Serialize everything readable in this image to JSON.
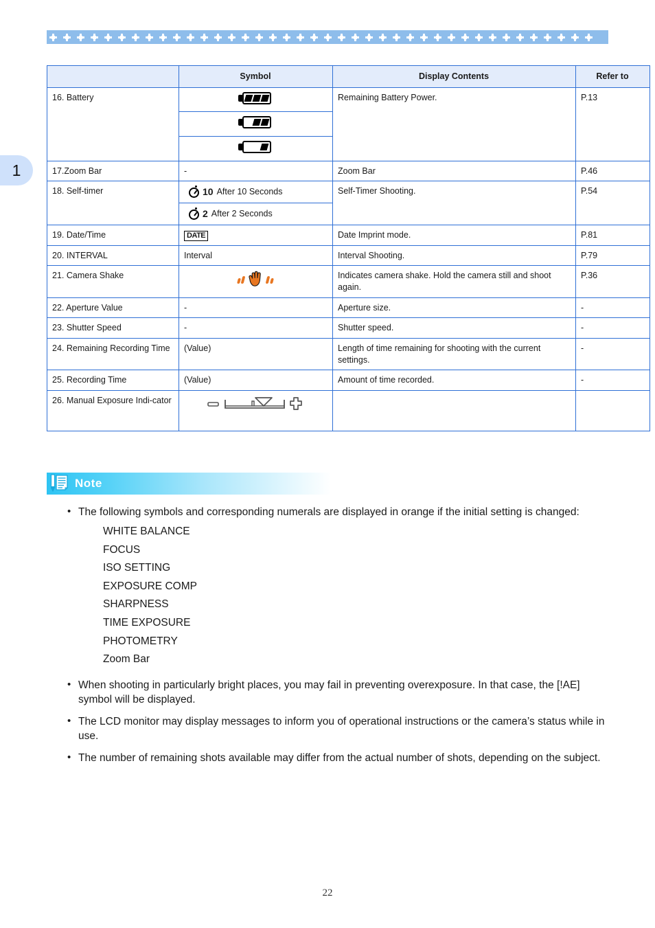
{
  "page": {
    "chapter_tab": "1",
    "page_number": "22"
  },
  "table": {
    "headers": [
      "",
      "Symbol",
      "Display Contents",
      "Refer to"
    ],
    "rows": [
      {
        "item": "16. Battery",
        "symbol_type": "battery-levels",
        "symbol_text": "",
        "display": "Remaining Battery Power.",
        "refer": "P.13"
      },
      {
        "item": "17.Zoom Bar",
        "symbol_type": "text",
        "symbol_text": "-",
        "display": "Zoom Bar",
        "refer": "P.46"
      },
      {
        "item": "18. Self-timer",
        "symbol_type": "self-timer",
        "symbol_text": "",
        "timer_options": [
          {
            "value": "10",
            "label": "After 10 Seconds"
          },
          {
            "value": "2",
            "label": "After 2 Seconds"
          }
        ],
        "display": "Self-Timer Shooting.",
        "refer": "P.54"
      },
      {
        "item": "19. Date/Time",
        "symbol_type": "date-badge",
        "symbol_text": "DATE",
        "display": "Date Imprint mode.",
        "refer": "P.81"
      },
      {
        "item": "20. INTERVAL",
        "symbol_type": "text",
        "symbol_text": "Interval",
        "display": "Interval Shooting.",
        "refer": "P.79"
      },
      {
        "item": "21. Camera Shake",
        "symbol_type": "camera-shake",
        "symbol_text": "",
        "display": "Indicates camera shake. Hold the camera still and shoot again.",
        "refer": "P.36"
      },
      {
        "item": "22. Aperture Value",
        "symbol_type": "text",
        "symbol_text": "-",
        "display": "Aperture size.",
        "refer": "-"
      },
      {
        "item": "23. Shutter Speed",
        "symbol_type": "text",
        "symbol_text": "-",
        "display": "Shutter speed.",
        "refer": "-"
      },
      {
        "item": "24. Remaining Recording Time",
        "symbol_type": "text",
        "symbol_text": "(Value)",
        "display": "Length of time remaining for shooting with the current settings.",
        "refer": "-"
      },
      {
        "item": "25. Recording Time",
        "symbol_type": "text",
        "symbol_text": "(Value)",
        "display": "Amount of time recorded.",
        "refer": "-"
      },
      {
        "item": "26. Manual Exposure Indi-cator",
        "symbol_type": "exposure-indicator",
        "symbol_text": "",
        "display": "",
        "refer": ""
      }
    ]
  },
  "note": {
    "title": "Note",
    "icon": "notepad-pencil-icon",
    "items": [
      {
        "text": "The following symbols and corresponding numerals are displayed in orange if the initial setting is changed:",
        "sub_items": [
          "WHITE BALANCE",
          "FOCUS",
          "ISO SETTING",
          "EXPOSURE COMP",
          "SHARPNESS",
          "TIME EXPOSURE",
          "PHOTOMETRY",
          "Zoom Bar"
        ]
      },
      {
        "text": "When shooting in particularly bright places, you may fail in preventing overexposure. In that case, the [!AE] symbol will be displayed.",
        "sub_items": []
      },
      {
        "text": "The LCD monitor may display messages to inform you of operational instructions or the camera’s status while in use.",
        "sub_items": []
      },
      {
        "text": "The number of remaining shots available may differ from the actual number of shots, depending on the subject.",
        "sub_items": []
      }
    ],
    "bullet": "•"
  },
  "colors": {
    "table_border": "#2e6fd6",
    "table_header_fill": "#e3ecfb",
    "header_band": "#8ebdeb",
    "tab_fill": "#cfe1fb",
    "note_accent": "#2ec4f3",
    "shake_orange": "#e87722"
  }
}
